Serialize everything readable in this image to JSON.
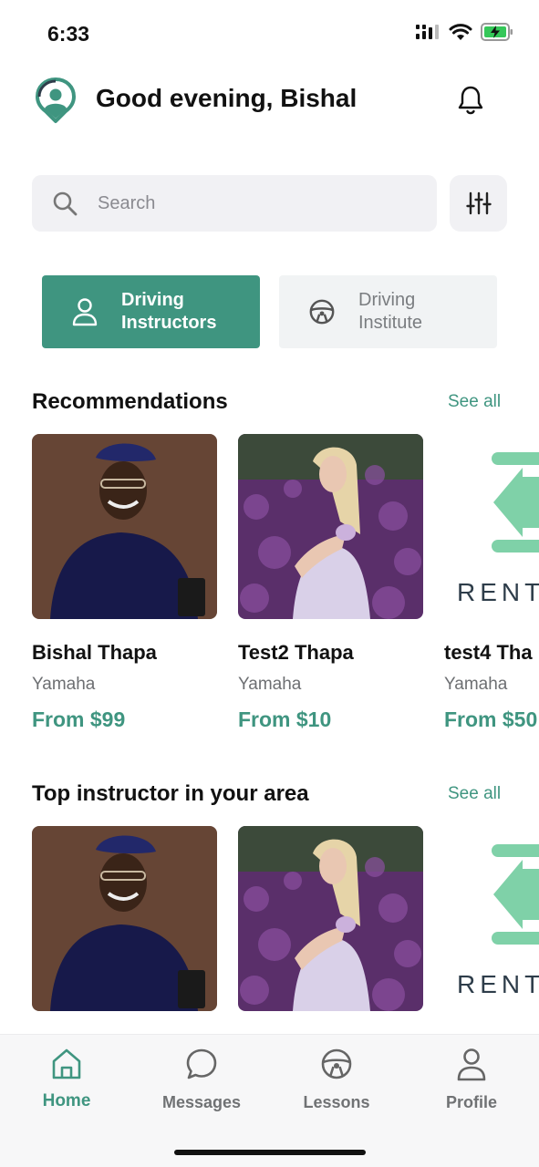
{
  "status_bar": {
    "time": "6:33"
  },
  "header": {
    "greeting": "Good evening, Bishal"
  },
  "search": {
    "placeholder": "Search"
  },
  "categories": [
    {
      "label_line1": "Driving",
      "label_line2": "Instructors",
      "icon": "person-icon",
      "active": true
    },
    {
      "label_line1": "Driving",
      "label_line2": "Institute",
      "icon": "steering-wheel-icon",
      "active": false
    }
  ],
  "recommendations": {
    "title": "Recommendations",
    "see_all": "See all",
    "items": [
      {
        "name": "Bishal Thapa",
        "bike": "Yamaha",
        "price": "From $99"
      },
      {
        "name": "Test2  Thapa",
        "bike": "Yamaha",
        "price": "From $10"
      },
      {
        "name": "test4 Tha",
        "bike": "Yamaha",
        "price": "From $50",
        "logo_text": "RENT"
      }
    ]
  },
  "top_instructors": {
    "title": "Top instructor in your area",
    "see_all": "See all",
    "items": [
      {
        "photo": "man-photo"
      },
      {
        "photo": "woman-photo"
      },
      {
        "logo_text": "RENT"
      }
    ]
  },
  "bottom_nav": {
    "items": [
      {
        "label": "Home",
        "icon": "home-icon",
        "active": true
      },
      {
        "label": "Messages",
        "icon": "chat-icon",
        "active": false
      },
      {
        "label": "Lessons",
        "icon": "steering-wheel-icon",
        "active": false
      },
      {
        "label": "Profile",
        "icon": "person-icon",
        "active": false
      }
    ]
  },
  "colors": {
    "accent": "#3f9580",
    "logo_green": "#7fd1a8",
    "text_dark": "#111111",
    "muted": "#6d6f72"
  }
}
